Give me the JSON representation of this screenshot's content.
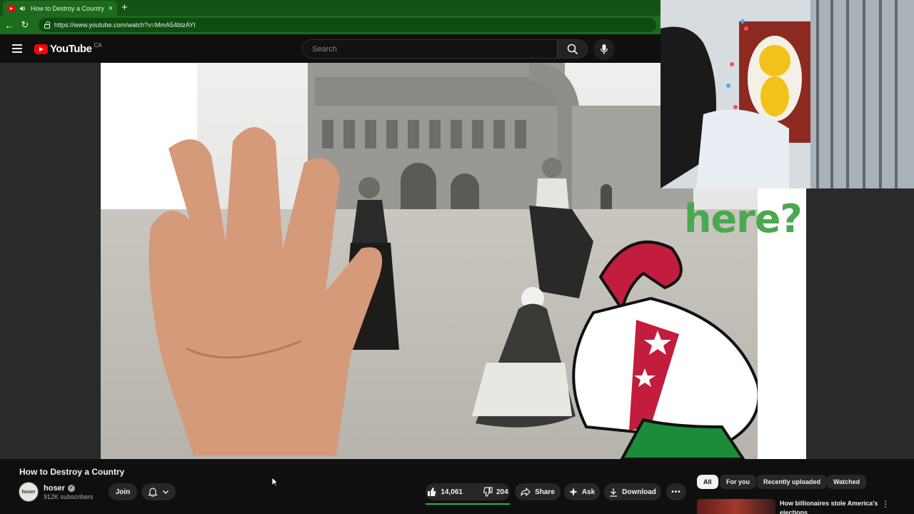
{
  "browser": {
    "tab_title": "How to Destroy a Country -",
    "new_tab": "+",
    "url": "https://www.youtube.com/watch?v=MmA54btzAYI",
    "accent": "#1d6b1d"
  },
  "header": {
    "logo_text": "YouTube",
    "country": "CA",
    "search_placeholder": "Search"
  },
  "video": {
    "overlay_text": "here?",
    "title": "How to Destroy a Country"
  },
  "channel": {
    "avatar_text": "hoser",
    "name": "hoser",
    "subscribers": "912K subscribers",
    "join_label": "Join"
  },
  "actions": {
    "likes": "14,061",
    "dislikes": "204",
    "share": "Share",
    "ask": "Ask",
    "download": "Download"
  },
  "chips": [
    {
      "label": "All",
      "active": true
    },
    {
      "label": "For you"
    },
    {
      "label": "Recently uploaded"
    },
    {
      "label": "Watched"
    }
  ],
  "recommendation": {
    "title": "How billionaires stole America's elections"
  }
}
